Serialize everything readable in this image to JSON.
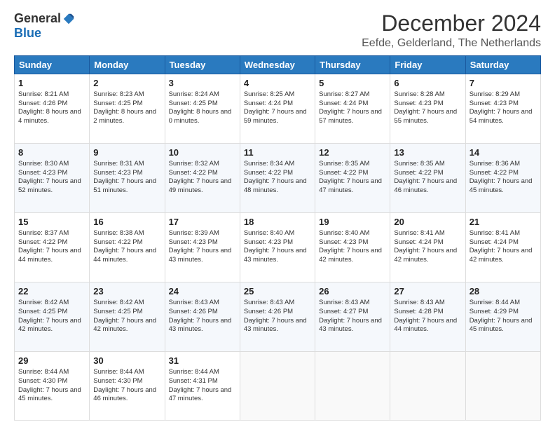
{
  "logo": {
    "general": "General",
    "blue": "Blue"
  },
  "title": "December 2024",
  "subtitle": "Eefde, Gelderland, The Netherlands",
  "days": [
    "Sunday",
    "Monday",
    "Tuesday",
    "Wednesday",
    "Thursday",
    "Friday",
    "Saturday"
  ],
  "weeks": [
    [
      {
        "day": "1",
        "sunrise": "8:21 AM",
        "sunset": "4:26 PM",
        "daylight": "8 hours and 4 minutes"
      },
      {
        "day": "2",
        "sunrise": "8:23 AM",
        "sunset": "4:25 PM",
        "daylight": "8 hours and 2 minutes"
      },
      {
        "day": "3",
        "sunrise": "8:24 AM",
        "sunset": "4:25 PM",
        "daylight": "8 hours and 0 minutes"
      },
      {
        "day": "4",
        "sunrise": "8:25 AM",
        "sunset": "4:24 PM",
        "daylight": "7 hours and 59 minutes"
      },
      {
        "day": "5",
        "sunrise": "8:27 AM",
        "sunset": "4:24 PM",
        "daylight": "7 hours and 57 minutes"
      },
      {
        "day": "6",
        "sunrise": "8:28 AM",
        "sunset": "4:23 PM",
        "daylight": "7 hours and 55 minutes"
      },
      {
        "day": "7",
        "sunrise": "8:29 AM",
        "sunset": "4:23 PM",
        "daylight": "7 hours and 54 minutes"
      }
    ],
    [
      {
        "day": "8",
        "sunrise": "8:30 AM",
        "sunset": "4:23 PM",
        "daylight": "7 hours and 52 minutes"
      },
      {
        "day": "9",
        "sunrise": "8:31 AM",
        "sunset": "4:23 PM",
        "daylight": "7 hours and 51 minutes"
      },
      {
        "day": "10",
        "sunrise": "8:32 AM",
        "sunset": "4:22 PM",
        "daylight": "7 hours and 49 minutes"
      },
      {
        "day": "11",
        "sunrise": "8:34 AM",
        "sunset": "4:22 PM",
        "daylight": "7 hours and 48 minutes"
      },
      {
        "day": "12",
        "sunrise": "8:35 AM",
        "sunset": "4:22 PM",
        "daylight": "7 hours and 47 minutes"
      },
      {
        "day": "13",
        "sunrise": "8:35 AM",
        "sunset": "4:22 PM",
        "daylight": "7 hours and 46 minutes"
      },
      {
        "day": "14",
        "sunrise": "8:36 AM",
        "sunset": "4:22 PM",
        "daylight": "7 hours and 45 minutes"
      }
    ],
    [
      {
        "day": "15",
        "sunrise": "8:37 AM",
        "sunset": "4:22 PM",
        "daylight": "7 hours and 44 minutes"
      },
      {
        "day": "16",
        "sunrise": "8:38 AM",
        "sunset": "4:22 PM",
        "daylight": "7 hours and 44 minutes"
      },
      {
        "day": "17",
        "sunrise": "8:39 AM",
        "sunset": "4:23 PM",
        "daylight": "7 hours and 43 minutes"
      },
      {
        "day": "18",
        "sunrise": "8:40 AM",
        "sunset": "4:23 PM",
        "daylight": "7 hours and 43 minutes"
      },
      {
        "day": "19",
        "sunrise": "8:40 AM",
        "sunset": "4:23 PM",
        "daylight": "7 hours and 42 minutes"
      },
      {
        "day": "20",
        "sunrise": "8:41 AM",
        "sunset": "4:24 PM",
        "daylight": "7 hours and 42 minutes"
      },
      {
        "day": "21",
        "sunrise": "8:41 AM",
        "sunset": "4:24 PM",
        "daylight": "7 hours and 42 minutes"
      }
    ],
    [
      {
        "day": "22",
        "sunrise": "8:42 AM",
        "sunset": "4:25 PM",
        "daylight": "7 hours and 42 minutes"
      },
      {
        "day": "23",
        "sunrise": "8:42 AM",
        "sunset": "4:25 PM",
        "daylight": "7 hours and 42 minutes"
      },
      {
        "day": "24",
        "sunrise": "8:43 AM",
        "sunset": "4:26 PM",
        "daylight": "7 hours and 43 minutes"
      },
      {
        "day": "25",
        "sunrise": "8:43 AM",
        "sunset": "4:26 PM",
        "daylight": "7 hours and 43 minutes"
      },
      {
        "day": "26",
        "sunrise": "8:43 AM",
        "sunset": "4:27 PM",
        "daylight": "7 hours and 43 minutes"
      },
      {
        "day": "27",
        "sunrise": "8:43 AM",
        "sunset": "4:28 PM",
        "daylight": "7 hours and 44 minutes"
      },
      {
        "day": "28",
        "sunrise": "8:44 AM",
        "sunset": "4:29 PM",
        "daylight": "7 hours and 45 minutes"
      }
    ],
    [
      {
        "day": "29",
        "sunrise": "8:44 AM",
        "sunset": "4:30 PM",
        "daylight": "7 hours and 45 minutes"
      },
      {
        "day": "30",
        "sunrise": "8:44 AM",
        "sunset": "4:30 PM",
        "daylight": "7 hours and 46 minutes"
      },
      {
        "day": "31",
        "sunrise": "8:44 AM",
        "sunset": "4:31 PM",
        "daylight": "7 hours and 47 minutes"
      },
      null,
      null,
      null,
      null
    ]
  ],
  "labels": {
    "sunrise": "Sunrise:",
    "sunset": "Sunset:",
    "daylight": "Daylight:"
  }
}
